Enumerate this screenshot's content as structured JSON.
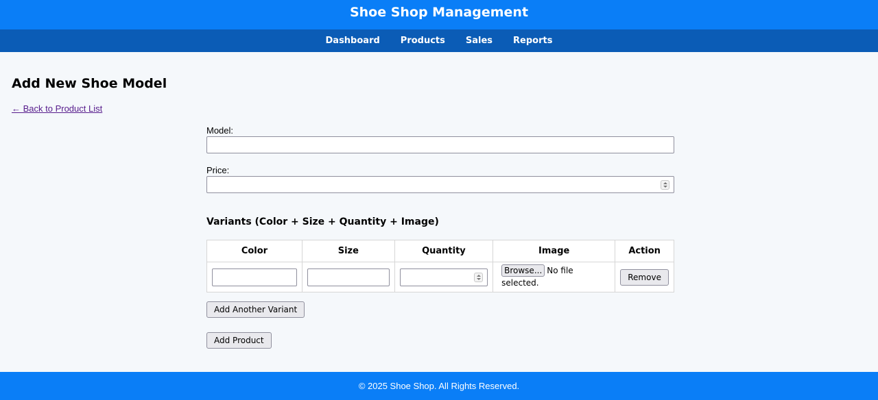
{
  "header": {
    "title": "Shoe Shop Management"
  },
  "nav": {
    "items": [
      "Dashboard",
      "Products",
      "Sales",
      "Reports"
    ]
  },
  "page": {
    "title": "Add New Shoe Model",
    "back_link": "← Back to Product List"
  },
  "form": {
    "model_label": "Model:",
    "model_value": "",
    "price_label": "Price:",
    "price_value": ""
  },
  "variants": {
    "title": "Variants (Color + Size + Quantity + Image)",
    "columns": [
      "Color",
      "Size",
      "Quantity",
      "Image",
      "Action"
    ],
    "row": {
      "color": "",
      "size": "",
      "quantity": "",
      "browse_label": "Browse...",
      "file_status": "No file selected.",
      "remove_label": "Remove"
    },
    "add_variant_label": "Add Another Variant"
  },
  "submit_label": "Add Product",
  "footer": {
    "text": "© 2025 Shoe Shop. All Rights Reserved."
  },
  "colors": {
    "primary": "#0a7ef7",
    "nav": "#0b5cb6",
    "background": "#f5f8fb"
  }
}
